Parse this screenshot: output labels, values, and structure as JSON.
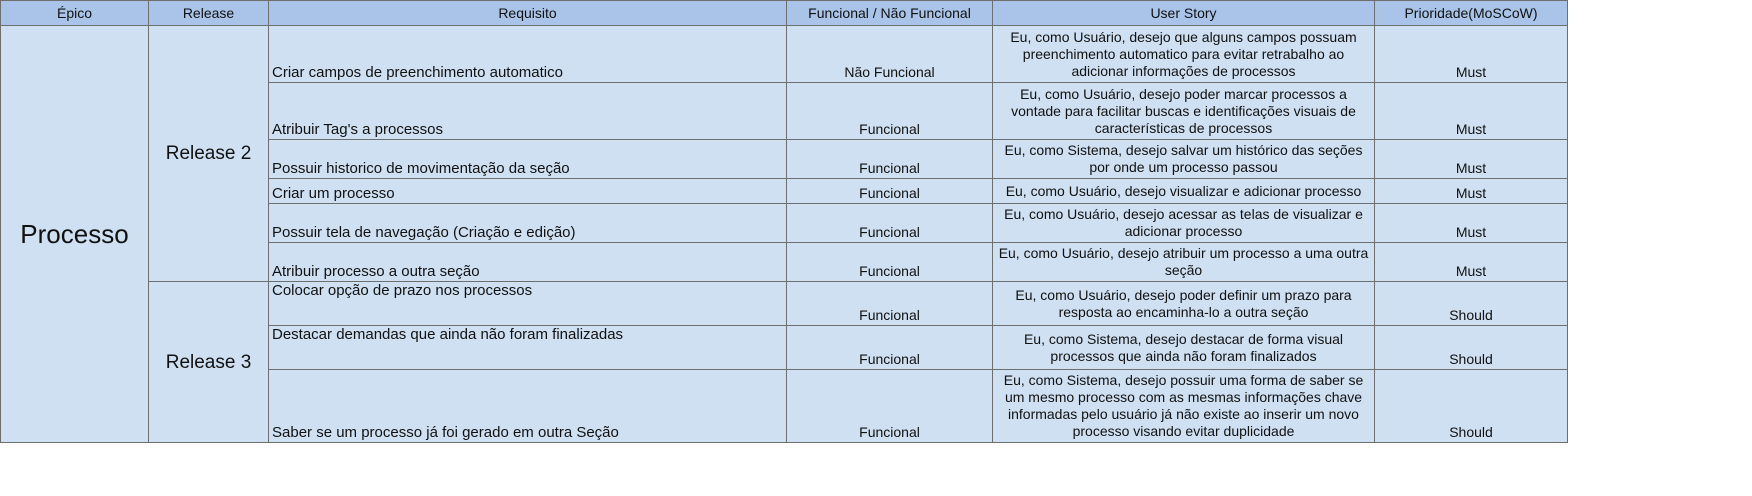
{
  "headers": {
    "epico": "Épico",
    "release": "Release",
    "requisito": "Requisito",
    "tipo": "Funcional / Não Funcional",
    "user_story": "User Story",
    "prioridade": "Prioridade(MoSCoW)"
  },
  "epic": "Processo",
  "release2": "Release 2",
  "release3": "Release 3",
  "rows": [
    {
      "requisito": "Criar campos de preenchimento automatico",
      "tipo": "Não Funcional",
      "user_story": "Eu, como Usuário, desejo que alguns campos possuam preenchimento automatico para evitar retrabalho ao adicionar informações de processos",
      "prioridade": "Must"
    },
    {
      "requisito": "Atribuir Tag's a processos",
      "tipo": "Funcional",
      "user_story": "Eu, como Usuário, desejo poder marcar processos a vontade para facilitar buscas e identificações visuais de características de processos",
      "prioridade": "Must"
    },
    {
      "requisito": "Possuir historico de movimentação da seção",
      "tipo": "Funcional",
      "user_story": "Eu, como Sistema, desejo salvar um histórico das seções por onde um processo passou",
      "prioridade": "Must"
    },
    {
      "requisito": "Criar um processo",
      "tipo": "Funcional",
      "user_story": "Eu, como Usuário, desejo visualizar e adicionar processo",
      "prioridade": "Must"
    },
    {
      "requisito": "Possuir tela de navegação (Criação e edição)",
      "tipo": "Funcional",
      "user_story": "Eu, como Usuário, desejo acessar as telas de visualizar e adicionar processo",
      "prioridade": "Must"
    },
    {
      "requisito": "Atribuir processo a outra seção",
      "tipo": "Funcional",
      "user_story": "Eu, como Usuário, desejo atribuir um processo a uma outra seção",
      "prioridade": "Must"
    },
    {
      "requisito": "Colocar opção de prazo nos processos",
      "tipo": "Funcional",
      "user_story": "Eu, como Usuário, desejo poder definir um prazo para resposta ao encaminha-lo a outra seção",
      "prioridade": "Should"
    },
    {
      "requisito": "Destacar demandas que ainda não foram finalizadas",
      "tipo": "Funcional",
      "user_story": "Eu, como Sistema, desejo destacar de forma visual processos que ainda não foram finalizados",
      "prioridade": "Should"
    },
    {
      "requisito": "Saber se um processo já foi gerado em outra Seção",
      "tipo": "Funcional",
      "user_story": "Eu, como Sistema, desejo possuir uma forma de saber se um mesmo processo com as mesmas informações chave informadas pelo usuário já não existe ao inserir um novo processo visando evitar duplicidade",
      "prioridade": "Should"
    }
  ]
}
